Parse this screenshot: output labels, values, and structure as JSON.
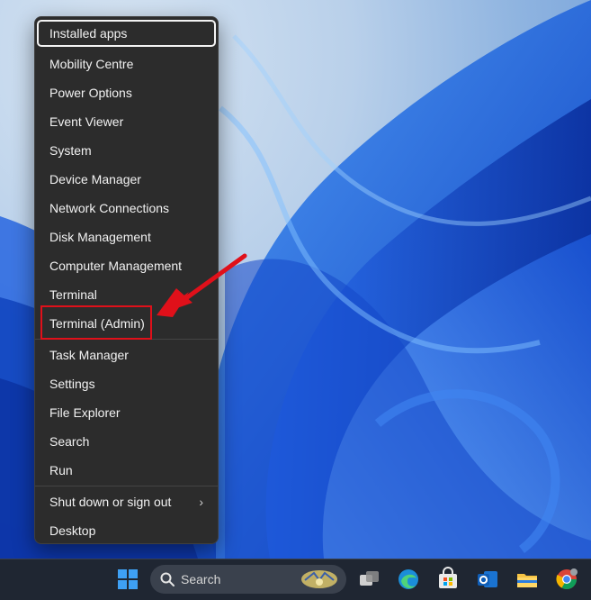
{
  "menu": {
    "items": [
      {
        "label": "Installed apps",
        "name": "menu-item-installed-apps",
        "focused": true
      },
      {
        "label": "Mobility Centre",
        "name": "menu-item-mobility-centre"
      },
      {
        "label": "Power Options",
        "name": "menu-item-power-options"
      },
      {
        "label": "Event Viewer",
        "name": "menu-item-event-viewer"
      },
      {
        "label": "System",
        "name": "menu-item-system"
      },
      {
        "label": "Device Manager",
        "name": "menu-item-device-manager"
      },
      {
        "label": "Network Connections",
        "name": "menu-item-network-connections"
      },
      {
        "label": "Disk Management",
        "name": "menu-item-disk-management"
      },
      {
        "label": "Computer Management",
        "name": "menu-item-computer-management"
      },
      {
        "label": "Terminal",
        "name": "menu-item-terminal"
      },
      {
        "label": "Terminal (Admin)",
        "name": "menu-item-terminal-admin"
      },
      {
        "label": "Task Manager",
        "name": "menu-item-task-manager"
      },
      {
        "label": "Settings",
        "name": "menu-item-settings"
      },
      {
        "label": "File Explorer",
        "name": "menu-item-file-explorer"
      },
      {
        "label": "Search",
        "name": "menu-item-search"
      },
      {
        "label": "Run",
        "name": "menu-item-run"
      },
      {
        "label": "Shut down or sign out",
        "name": "menu-item-shut-down",
        "submenu": true
      },
      {
        "label": "Desktop",
        "name": "menu-item-desktop"
      }
    ],
    "chevron": "›"
  },
  "annotation": {
    "highlight_color": "#e0101a",
    "highlighted_item": "Terminal (Admin)"
  },
  "taskbar": {
    "search_placeholder": "Search",
    "icons": [
      "start-icon",
      "search-icon",
      "task-view-icon",
      "edge-icon",
      "store-icon",
      "outlook-icon",
      "file-explorer-icon",
      "chrome-icon"
    ]
  },
  "colors": {
    "menu_bg": "#2c2c2c",
    "taskbar_bg": "#1f2632",
    "wallpaper_blue": "#1f5ad8"
  }
}
